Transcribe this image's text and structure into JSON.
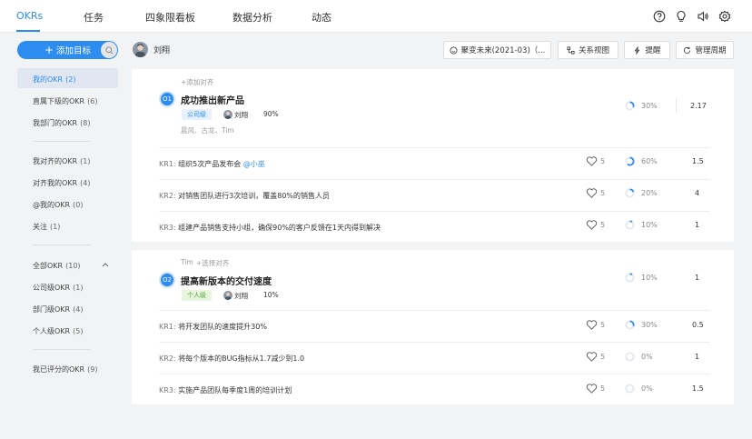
{
  "nav": {
    "items": [
      "OKRs",
      "任务",
      "四象限看板",
      "数据分析",
      "动态"
    ],
    "icons": [
      "help-circle-icon",
      "bulb-icon",
      "speaker-icon",
      "gear-icon"
    ]
  },
  "sidebar": {
    "add_goal_label": "添加目标",
    "items": [
      {
        "label": "我的OKR",
        "count": "(2)"
      },
      {
        "label": "直属下级的OKR",
        "count": "(6)"
      },
      {
        "label": "我部门的OKR",
        "count": "(8)"
      },
      {
        "label": "我对齐的OKR",
        "count": "(1)"
      },
      {
        "label": "对齐我的OKR",
        "count": "(4)"
      },
      {
        "label": "@我的OKR",
        "count": "(0)"
      },
      {
        "label": "关注",
        "count": "(1)"
      },
      {
        "label": "全部OKR",
        "count": "(10)"
      },
      {
        "label": "公司级OKR",
        "count": "(1)"
      },
      {
        "label": "部门级OKR",
        "count": "(4)"
      },
      {
        "label": "个人级OKR",
        "count": "(5)"
      },
      {
        "label": "我已评分的OKR",
        "count": "(9)"
      }
    ]
  },
  "header": {
    "user_name": "刘翔",
    "cycle_label": "聚变未来(2021-03)（...",
    "relation_label": "关系视图",
    "remind_label": "提醒",
    "manage_cycle_label": "管理周期"
  },
  "objectives": [
    {
      "index": "O1",
      "title": "成功推出新产品",
      "align_prefix": "",
      "align_label": "+添加对齐",
      "tag": "公司级",
      "owner": "刘翔",
      "owner_progress": "90%",
      "collaborators": "晨风、古龙、Tim",
      "progress": "30%",
      "progress_value": 0.3,
      "score": "2.17",
      "krs": [
        {
          "no": "KR1:",
          "text": "组织5次产品发布会 ",
          "mention": "@小巫",
          "likes": "5",
          "progress": "60%",
          "progress_value": 0.6,
          "score": "1.5"
        },
        {
          "no": "KR2:",
          "text": "对销售团队进行3次培训，覆盖80%的销售人员",
          "mention": "",
          "likes": "5",
          "progress": "20%",
          "progress_value": 0.2,
          "score": "4"
        },
        {
          "no": "KR3:",
          "text": "组建产品销售支持小组，确保90%的客户反馈在1天内得到解决",
          "mention": "",
          "likes": "5",
          "progress": "10%",
          "progress_value": 0.1,
          "score": "1"
        }
      ]
    },
    {
      "index": "O2",
      "title": "提高新版本的交付速度",
      "align_prefix": "Tim",
      "align_label": "+选择对齐",
      "tag": "个人级",
      "owner": "刘翔",
      "owner_progress": "10%",
      "collaborators": "",
      "progress": "10%",
      "progress_value": 0.1,
      "score": "1",
      "krs": [
        {
          "no": "KR1:",
          "text": "将开发团队的速度提升30%",
          "mention": "",
          "likes": "5",
          "progress": "30%",
          "progress_value": 0.3,
          "score": "0.5"
        },
        {
          "no": "KR2:",
          "text": "将每个版本的BUG指标从1.7减少到1.0",
          "mention": "",
          "likes": "5",
          "progress": "0%",
          "progress_value": 0.0,
          "score": "1"
        },
        {
          "no": "KR3:",
          "text": "实施产品团队每季度1周的培训计划",
          "mention": "",
          "likes": "5",
          "progress": "0%",
          "progress_value": 0.0,
          "score": "1.5"
        }
      ]
    }
  ],
  "colors": {
    "accent": "#2d8cf0",
    "company_tag_bg": "#e6f1fd",
    "personal_tag_bg": "#e7f6dc",
    "personal_tag_fg": "#52a436"
  }
}
